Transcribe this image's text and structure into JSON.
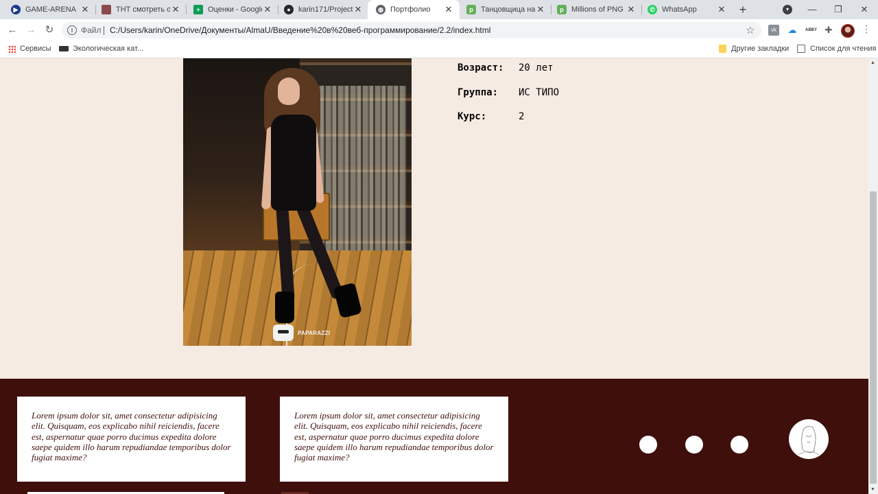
{
  "tabs": [
    {
      "title": "GAME-ARENA",
      "icon": "game-arena-icon",
      "color": "#1a3a8a",
      "active": false
    },
    {
      "title": "ТНТ смотреть он",
      "icon": "tnt-icon",
      "color": "#8a4a4a",
      "active": false
    },
    {
      "title": "Оценки - Google",
      "icon": "google-sheets-icon",
      "color": "#0f9d58",
      "active": false
    },
    {
      "title": "karin171/Project-",
      "icon": "github-icon",
      "color": "#24292e",
      "active": false
    },
    {
      "title": "Портфолио",
      "icon": "globe-icon",
      "color": "#5f6368",
      "active": true
    },
    {
      "title": "Танцовщица на",
      "icon": "pngtree-icon",
      "color": "#64b05a",
      "active": false
    },
    {
      "title": "Millions of PNG In",
      "icon": "pngtree-icon",
      "color": "#64b05a",
      "active": false
    },
    {
      "title": "WhatsApp",
      "icon": "whatsapp-icon",
      "color": "#25d366",
      "active": false
    }
  ],
  "toolbar": {
    "site_info_label": "Файл",
    "url": "C:/Users/karin/OneDrive/Документы/AlmaU/Введение%20в%20веб-программирование/2.2/index.html"
  },
  "bookmarks": {
    "apps": "Сервисы",
    "eco": "Экологическая кат...",
    "other": "Другие закладки",
    "reading_list": "Список для чтения"
  },
  "photo": {
    "watermark": "PAPARAZZI"
  },
  "profile": {
    "rows": [
      {
        "key": "Возраст:",
        "value": "20 лет"
      },
      {
        "key": "Группа:",
        "value": "ИС ТИПО"
      },
      {
        "key": "Курс:",
        "value": "2"
      }
    ]
  },
  "footer": {
    "cards": [
      {
        "text": "Lorem ipsum dolor sit, amet consectetur adipisicing elit. Quisquam, eos explicabo nihil reiciendis, facere est, aspernatur quae porro ducimus expedita dolore saepe quidem illo harum repudiandae temporibus dolor fugiat maxime?"
      },
      {
        "text": "Lorem ipsum dolor sit, amet consectetur adipisicing elit. Quisquam, eos explicabo nihil reiciendis, facere est, aspernatur quae porro ducimus expedita dolore saepe quidem illo harum repudiandae temporibus dolor fugiat maxime?"
      }
    ]
  },
  "colors": {
    "page_bg": "#f6ebe3",
    "footer_bg": "#3e0f0b",
    "card_text": "#3e0f0b"
  }
}
